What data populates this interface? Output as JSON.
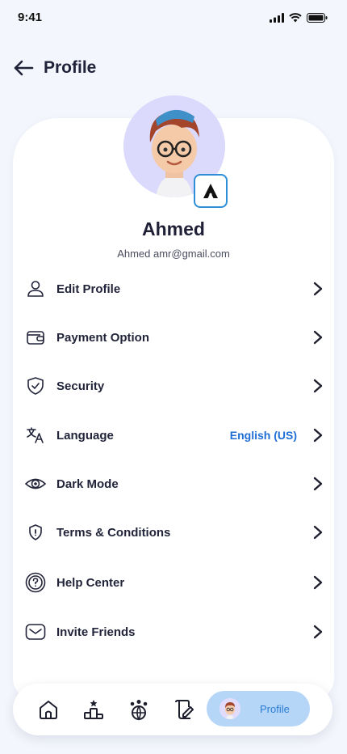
{
  "status_bar": {
    "time": "9:41"
  },
  "header": {
    "title": "Profile"
  },
  "profile": {
    "name": "Ahmed",
    "email": "Ahmed amr@gmail.com",
    "badge_letter": "A"
  },
  "menu": [
    {
      "label": "Edit Profile",
      "icon": "user-icon"
    },
    {
      "label": "Payment Option",
      "icon": "wallet-icon"
    },
    {
      "label": "Security",
      "icon": "shield-check-icon"
    },
    {
      "label": "Language",
      "icon": "translate-icon",
      "value": "English (US)"
    },
    {
      "label": "Dark Mode",
      "icon": "eye-icon"
    },
    {
      "label": "Terms & Conditions",
      "icon": "shield-icon"
    },
    {
      "label": "Help Center",
      "icon": "help-icon"
    },
    {
      "label": "Invite Friends",
      "icon": "mail-icon"
    }
  ],
  "bottom_nav": {
    "items": [
      "home-icon",
      "leaderboard-icon",
      "community-icon",
      "notes-icon"
    ],
    "active_label": "Profile"
  },
  "colors": {
    "accent": "#1f6fd6",
    "active_nav_bg": "#b6d6f8",
    "background": "#f4f6fd"
  }
}
